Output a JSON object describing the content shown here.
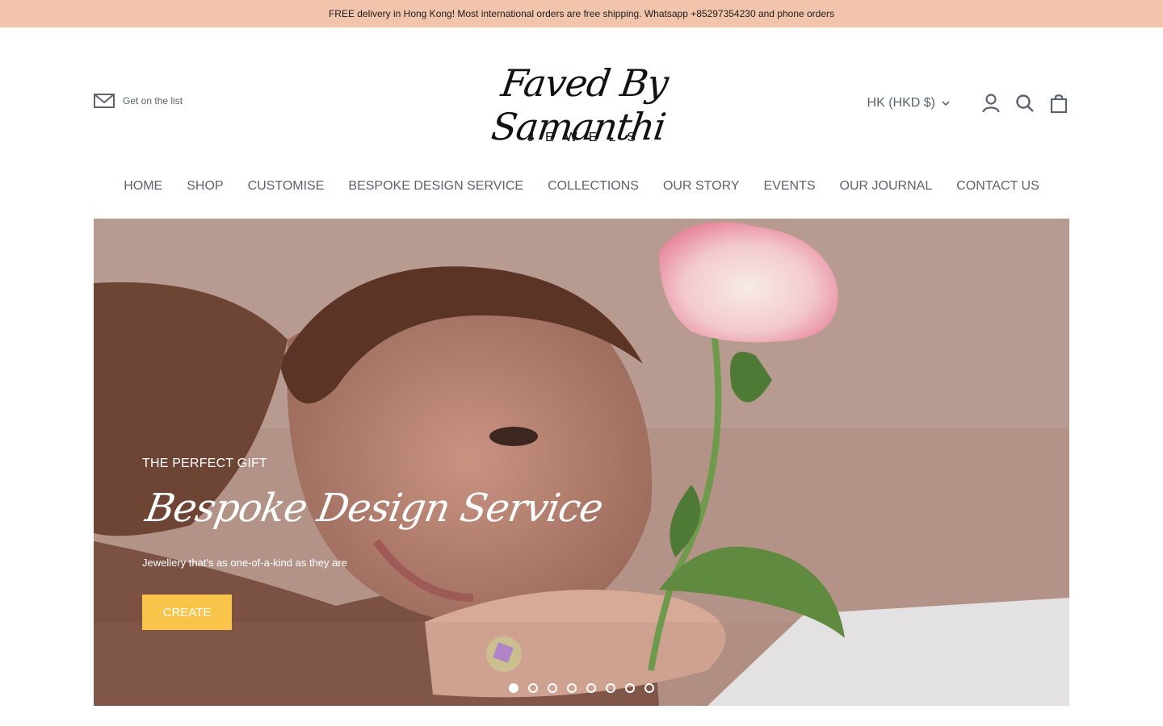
{
  "announcement": {
    "text": "FREE delivery in Hong Kong! Most international orders are free shipping. Whatsapp +85297354230 and phone orders"
  },
  "header": {
    "newsletter_label": "Get on the list",
    "logo_script": "Faved By Samanthi",
    "logo_sub": "JEWELS",
    "currency": "HK (HKD $)",
    "icons": [
      "mail-icon",
      "chevron-down-icon",
      "account-icon",
      "search-icon",
      "bag-icon"
    ]
  },
  "nav": {
    "items": [
      {
        "label": "HOME"
      },
      {
        "label": "SHOP"
      },
      {
        "label": "CUSTOMISE"
      },
      {
        "label": "BESPOKE DESIGN SERVICE"
      },
      {
        "label": "COLLECTIONS"
      },
      {
        "label": "OUR STORY"
      },
      {
        "label": "EVENTS"
      },
      {
        "label": "OUR JOURNAL"
      },
      {
        "label": "CONTACT US"
      }
    ]
  },
  "hero": {
    "kicker": "THE PERFECT GIFT",
    "title": "Bespoke Design Service",
    "subtitle": "Jewellery that's as one-of-a-kind as they are",
    "cta_label": "CREATE",
    "slide_count": 8,
    "active_slide": 1
  },
  "colors": {
    "announcement_bg": "#f2c4ab",
    "nav_text": "#5e6270",
    "cta_bg": "#f8c54a"
  }
}
